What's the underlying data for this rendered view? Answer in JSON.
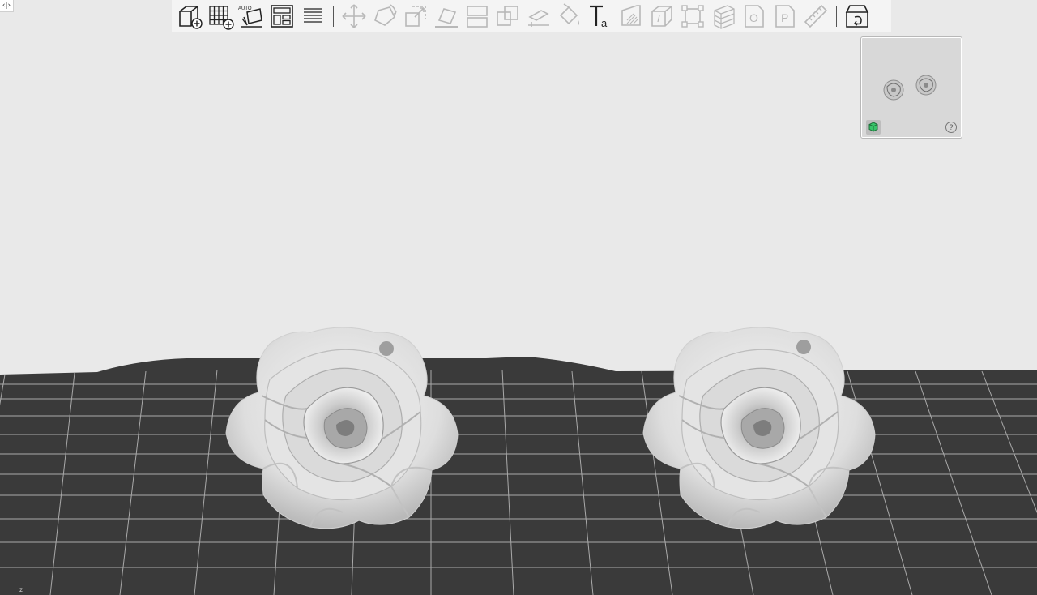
{
  "app": {
    "collapse_toggle_label": "‹|›",
    "axis_indicator": "z"
  },
  "toolbar": {
    "groups": [
      [
        {
          "name": "add-model",
          "icon": "cube-plus-icon",
          "enabled": true
        },
        {
          "name": "add-grid-template",
          "icon": "grid-plus-icon",
          "enabled": true
        },
        {
          "name": "auto-orient",
          "icon": "auto-orient-icon",
          "enabled": true,
          "text": "AUTO"
        },
        {
          "name": "layout",
          "icon": "layout-icon",
          "enabled": true
        },
        {
          "name": "layers",
          "icon": "layers-icon",
          "enabled": true
        }
      ],
      [
        {
          "name": "move",
          "icon": "move-icon",
          "enabled": false
        },
        {
          "name": "rotate",
          "icon": "rotate-icon",
          "enabled": false
        },
        {
          "name": "scale",
          "icon": "scale-icon",
          "enabled": false
        },
        {
          "name": "lay-flat",
          "icon": "lay-flat-icon",
          "enabled": false
        },
        {
          "name": "cut",
          "icon": "cut-icon",
          "enabled": false
        },
        {
          "name": "boolean",
          "icon": "boolean-icon",
          "enabled": false
        },
        {
          "name": "measure-height",
          "icon": "measure-height-icon",
          "enabled": false
        },
        {
          "name": "paint-bucket",
          "icon": "paint-bucket-icon",
          "enabled": false
        },
        {
          "name": "text",
          "icon": "text-icon",
          "enabled": true,
          "text": "Ta"
        },
        {
          "name": "support-paint",
          "icon": "support-paint-icon",
          "enabled": false
        },
        {
          "name": "hollow",
          "icon": "hollow-icon",
          "enabled": false
        },
        {
          "name": "bounding-box",
          "icon": "bounding-box-icon",
          "enabled": false
        },
        {
          "name": "slice-layers",
          "icon": "slice-layers-icon",
          "enabled": false
        },
        {
          "name": "outer-wall",
          "icon": "outer-wall-icon",
          "enabled": false,
          "text": "O"
        },
        {
          "name": "print-pages",
          "icon": "print-pages-icon",
          "enabled": false,
          "text": "P"
        },
        {
          "name": "ruler",
          "icon": "ruler-icon",
          "enabled": false
        }
      ],
      [
        {
          "name": "return-to-box",
          "icon": "return-box-icon",
          "enabled": true
        }
      ]
    ]
  },
  "navcube": {
    "view_mode_icon": "green-cube-icon",
    "help_label": "?"
  },
  "colors": {
    "background": "#e9e9e9",
    "bed": "#3a3a3a",
    "grid_line": "#bdbdbd",
    "model": "#e6e6e6",
    "accent_green": "#39c46a"
  }
}
